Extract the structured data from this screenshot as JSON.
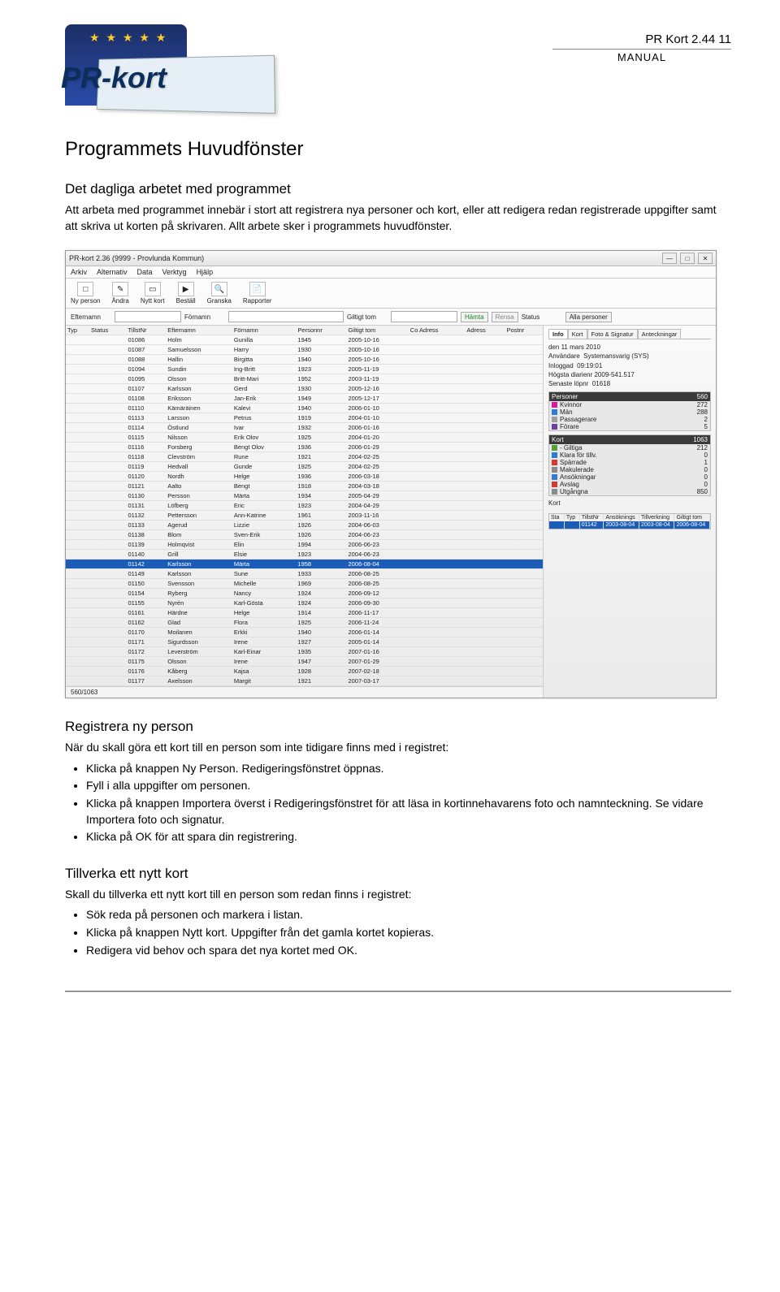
{
  "header": {
    "logo_text": "PR-kort",
    "title_line": "PR Kort  2.44    11",
    "manual": "MANUAL"
  },
  "h1": "Programmets Huvudfönster",
  "h2a": "Det dagliga arbetet med programmet",
  "p1": "Att arbeta med programmet innebär i stort att registrera nya personer och kort, eller att redigera redan registrerade uppgifter samt att skriva ut korten på skrivaren. Allt arbete sker i programmets huvudfönster.",
  "h2b": "Registrera ny person",
  "p2": "När du skall göra ett kort till en person som inte tidigare finns med i registret:",
  "bullets_b": [
    "Klicka på knappen Ny Person. Redigeringsfönstret öppnas.",
    "Fyll i alla uppgifter om personen.",
    "Klicka på knappen Importera överst i Redigeringsfönstret för att läsa in kortinnehavarens foto och namnteckning. Se vidare Importera foto och signatur.",
    "Klicka på OK för att spara din registrering."
  ],
  "h2c": "Tillverka ett nytt kort",
  "p3": "Skall du tillverka ett nytt kort till en person som redan finns i registret:",
  "bullets_c": [
    "Sök reda på personen och markera i listan.",
    "Klicka på knappen Nytt kort. Uppgifter från det gamla kortet kopieras.",
    "Redigera vid behov och spara det nya kortet med OK."
  ],
  "app": {
    "titlebar": "PR-kort 2.36 (9999 - Provlunda Kommun)",
    "menus": [
      "Arkiv",
      "Alternativ",
      "Data",
      "Verktyg",
      "Hjälp"
    ],
    "toolbar": [
      {
        "label": "Ny person",
        "icon": "□"
      },
      {
        "label": "Ändra",
        "icon": "✎"
      },
      {
        "label": "Nytt kort",
        "icon": "▭"
      },
      {
        "label": "Beställ",
        "icon": "▶"
      },
      {
        "label": "Granska",
        "icon": "🔍"
      },
      {
        "label": "Rapporter",
        "icon": "📄"
      }
    ],
    "filter": {
      "l_eft": "Efternamn",
      "l_for": "Förnamn",
      "l_gilt": "Giltigt tom",
      "l_status": "Status",
      "hamta": "Hämta",
      "rensa": "Rensa",
      "alla": "Alla personer"
    },
    "grid_headers": [
      "Typ",
      "Status",
      "TillstNr",
      "Efternamn",
      "Förnamn",
      "Personnr",
      "Giltigt tom",
      "Co Adress",
      "Adress",
      "Postnr"
    ],
    "rows": [
      [
        "",
        "",
        "01086",
        "Holm",
        "Gunilla",
        "1945",
        "2005-10-16",
        "",
        "",
        ""
      ],
      [
        "",
        "",
        "01087",
        "Samuelsson",
        "Harry",
        "1930",
        "2005-10-16",
        "",
        "",
        ""
      ],
      [
        "",
        "",
        "01088",
        "Hallin",
        "Birgitta",
        "1940",
        "2005-10-16",
        "",
        "",
        ""
      ],
      [
        "",
        "",
        "01094",
        "Sundin",
        "Ing-Britt",
        "1923",
        "2005-11-19",
        "",
        "",
        ""
      ],
      [
        "",
        "",
        "01095",
        "Olsson",
        "Britt-Mari",
        "1952",
        "2003-11-19",
        "",
        "",
        ""
      ],
      [
        "",
        "",
        "01107",
        "Karlsson",
        "Gerd",
        "1930",
        "2005-12-16",
        "",
        "",
        ""
      ],
      [
        "",
        "",
        "01108",
        "Eriksson",
        "Jan-Erik",
        "1949",
        "2005-12-17",
        "",
        "",
        ""
      ],
      [
        "",
        "",
        "01110",
        "Kämäräinen",
        "Kalevi",
        "1940",
        "2006-01-10",
        "",
        "",
        ""
      ],
      [
        "",
        "",
        "01113",
        "Larsson",
        "Petrus",
        "1919",
        "2004-01-10",
        "",
        "",
        ""
      ],
      [
        "",
        "",
        "01114",
        "Östlund",
        "Ivar",
        "1932",
        "2006-01-16",
        "",
        "",
        ""
      ],
      [
        "",
        "",
        "01115",
        "Nilsson",
        "Erik Olov",
        "1925",
        "2004-01-20",
        "",
        "",
        ""
      ],
      [
        "",
        "",
        "01116",
        "Forsberg",
        "Bengt Olov",
        "1936",
        "2006-01-29",
        "",
        "",
        ""
      ],
      [
        "",
        "",
        "01118",
        "Clevström",
        "Rune",
        "1921",
        "2004-02-25",
        "",
        "",
        ""
      ],
      [
        "",
        "",
        "01119",
        "Hedvall",
        "Gunde",
        "1925",
        "2004-02-25",
        "",
        "",
        ""
      ],
      [
        "",
        "",
        "01120",
        "Nordh",
        "Helge",
        "1936",
        "2006-03-18",
        "",
        "",
        ""
      ],
      [
        "",
        "",
        "01121",
        "Aalto",
        "Bengt",
        "1918",
        "2004-03-18",
        "",
        "",
        ""
      ],
      [
        "",
        "",
        "01130",
        "Persson",
        "Märta",
        "1934",
        "2005-04-29",
        "",
        "",
        ""
      ],
      [
        "",
        "",
        "01131",
        "Löfberg",
        "Eric",
        "1923",
        "2004-04-29",
        "",
        "",
        ""
      ],
      [
        "",
        "",
        "01132",
        "Pettersson",
        "Ann-Katrine",
        "1961",
        "2003-11-16",
        "",
        "",
        ""
      ],
      [
        "",
        "",
        "01133",
        "Agerud",
        "Lizzie",
        "1926",
        "2004-06-03",
        "",
        "",
        ""
      ],
      [
        "",
        "",
        "01138",
        "Blom",
        "Sven-Erik",
        "1926",
        "2004-06-23",
        "",
        "",
        ""
      ],
      [
        "",
        "",
        "01139",
        "Holmqvist",
        "Elin",
        "1994",
        "2006-06-23",
        "",
        "",
        ""
      ],
      [
        "",
        "",
        "01140",
        "Grill",
        "Elsie",
        "1923",
        "2004-06-23",
        "",
        "",
        ""
      ],
      [
        "",
        "",
        "01142",
        "Karlsson",
        "Märta",
        "1958",
        "2006-08-04",
        "",
        "",
        ""
      ],
      [
        "",
        "",
        "01149",
        "Karlsson",
        "Sune",
        "1933",
        "2006-08-25",
        "",
        "",
        ""
      ],
      [
        "",
        "",
        "01150",
        "Svensson",
        "Michelle",
        "1969",
        "2006-08-25",
        "",
        "",
        ""
      ],
      [
        "",
        "",
        "01154",
        "Ryberg",
        "Nancy",
        "1924",
        "2006-09-12",
        "",
        "",
        ""
      ],
      [
        "",
        "",
        "01155",
        "Nyrén",
        "Karl-Gösta",
        "1924",
        "2006-09-30",
        "",
        "",
        ""
      ],
      [
        "",
        "",
        "01161",
        "Härdne",
        "Helge",
        "1914",
        "2006-11-17",
        "",
        "",
        ""
      ],
      [
        "",
        "",
        "01162",
        "Glad",
        "Flora",
        "1925",
        "2006-11-24",
        "",
        "",
        ""
      ],
      [
        "",
        "",
        "01170",
        "Moilanen",
        "Erkki",
        "1940",
        "2006-01-14",
        "",
        "",
        ""
      ],
      [
        "",
        "",
        "01171",
        "Sigurdsson",
        "Irene",
        "1927",
        "2005-01-14",
        "",
        "",
        ""
      ],
      [
        "",
        "",
        "01172",
        "Leverström",
        "Karl-Einar",
        "1935",
        "2007-01-16",
        "",
        "",
        ""
      ],
      [
        "",
        "",
        "01175",
        "Olsson",
        "Irene",
        "1947",
        "2007-01-29",
        "",
        "",
        ""
      ],
      [
        "",
        "",
        "01176",
        "Kåberg",
        "Kajsa",
        "1928",
        "2007-02-18",
        "",
        "",
        ""
      ],
      [
        "",
        "",
        "01177",
        "Axelsson",
        "Margit",
        "1921",
        "2007-03-17",
        "",
        "",
        ""
      ]
    ],
    "selected_index": 23,
    "footer_count": "560/1063",
    "right": {
      "tabs": [
        "Info",
        "Kort",
        "Foto & Signatur",
        "Anteckningar"
      ],
      "date_line": "den 11 mars 2010",
      "anv_label": "Användare",
      "anv": "Systemansvarig (SYS)",
      "inlog_label": "Inloggad",
      "inlog": "09:19:01",
      "hog_label": "Högsta diarienr",
      "hog": "2009-541.517",
      "sen_label": "Senaste löpnr",
      "sen": "01618",
      "persons_head": "Personer",
      "persons_total": "560",
      "person_stats": [
        {
          "c": "#d81b9e",
          "l": "Kvinnor",
          "v": "272"
        },
        {
          "c": "#2f7bd1",
          "l": "Män",
          "v": "288"
        },
        {
          "c": "#9e9e9e",
          "l": "Passagerare",
          "v": "2"
        },
        {
          "c": "#6b3fa0",
          "l": "Förare",
          "v": "5"
        }
      ],
      "kort_head": "Kort",
      "kort_total": "1063",
      "kort_stats": [
        {
          "c": "#589f36",
          "l": "- Giltiga",
          "v": "212"
        },
        {
          "c": "#2f7bd1",
          "l": "Klara för tillv.",
          "v": "0"
        },
        {
          "c": "#d13a2f",
          "l": "Spärrade",
          "v": "1"
        },
        {
          "c": "#8a8a8a",
          "l": "Makulerade",
          "v": "0"
        },
        {
          "c": "#2f7bd1",
          "l": "Ansökningar",
          "v": "0"
        },
        {
          "c": "#d13a2f",
          "l": "Avslag",
          "v": "0"
        },
        {
          "c": "#8a8a8a",
          "l": "Utgångna",
          "v": "850"
        }
      ],
      "kort_label": "Kort",
      "kort_table_head": [
        "Sta",
        "Typ",
        "TillstNr",
        "Ansöknings",
        "Tillverkning",
        "Giltigt tom"
      ],
      "kort_table_row": [
        "",
        "",
        "01142",
        "2003-08-04",
        "2003-08-04",
        "2006-08-04"
      ]
    }
  }
}
